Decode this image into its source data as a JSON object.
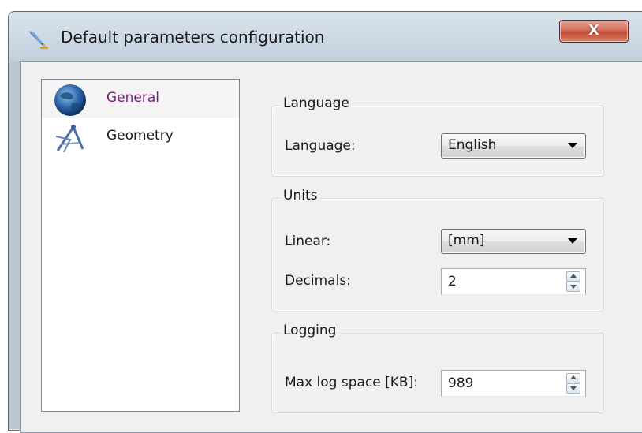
{
  "window": {
    "title": "Default parameters configuration",
    "close_label": "X"
  },
  "icons": {
    "app": "feather-pen-icon",
    "general": "globe-icon",
    "geometry": "drafting-compass-icon"
  },
  "tree": {
    "items": [
      {
        "label": "General",
        "selected": true
      },
      {
        "label": "Geometry",
        "selected": false
      }
    ]
  },
  "language_group": {
    "title": "Language",
    "language_label": "Language:",
    "language_value": "English"
  },
  "units_group": {
    "title": "Units",
    "linear_label": "Linear:",
    "linear_value": "[mm]",
    "decimals_label": "Decimals:",
    "decimals_value": "2"
  },
  "logging_group": {
    "title": "Logging",
    "max_log_label": "Max log space [KB]:",
    "max_log_value": "989"
  },
  "colors": {
    "selected_text": "#7a1a7a",
    "close_button": "#c24a33"
  }
}
